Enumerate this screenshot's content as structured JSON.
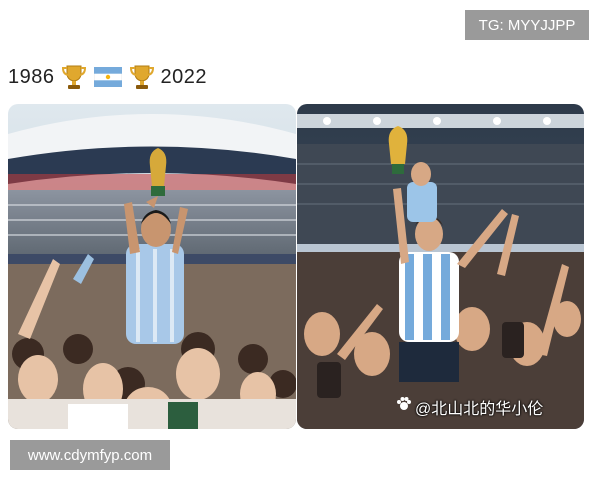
{
  "tg_badge": "TG: MYYJJPP",
  "caption": {
    "left_year": "1986",
    "right_year": "2022",
    "icons": [
      "trophy-icon",
      "argentina-flag-icon",
      "trophy-icon"
    ]
  },
  "photos": {
    "left": {
      "subject": "1986-trophy-celebration-photo"
    },
    "right": {
      "subject": "2022-trophy-celebration-photo",
      "watermark": "@北山北的华小伦"
    }
  },
  "url_badge": "www.cdymfyp.com",
  "colors": {
    "badge_gray": "#9a9a9a",
    "argentina_blue": "#75aadb",
    "trophy_gold": "#e0a82e"
  }
}
